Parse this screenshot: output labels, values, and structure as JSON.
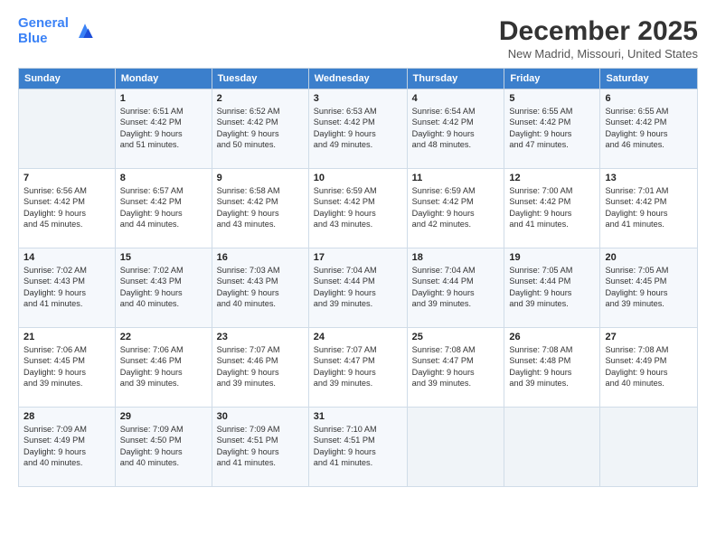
{
  "header": {
    "logo_line1": "General",
    "logo_line2": "Blue",
    "month": "December 2025",
    "location": "New Madrid, Missouri, United States"
  },
  "weekdays": [
    "Sunday",
    "Monday",
    "Tuesday",
    "Wednesday",
    "Thursday",
    "Friday",
    "Saturday"
  ],
  "weeks": [
    [
      {
        "num": "",
        "info": ""
      },
      {
        "num": "1",
        "info": "Sunrise: 6:51 AM\nSunset: 4:42 PM\nDaylight: 9 hours\nand 51 minutes."
      },
      {
        "num": "2",
        "info": "Sunrise: 6:52 AM\nSunset: 4:42 PM\nDaylight: 9 hours\nand 50 minutes."
      },
      {
        "num": "3",
        "info": "Sunrise: 6:53 AM\nSunset: 4:42 PM\nDaylight: 9 hours\nand 49 minutes."
      },
      {
        "num": "4",
        "info": "Sunrise: 6:54 AM\nSunset: 4:42 PM\nDaylight: 9 hours\nand 48 minutes."
      },
      {
        "num": "5",
        "info": "Sunrise: 6:55 AM\nSunset: 4:42 PM\nDaylight: 9 hours\nand 47 minutes."
      },
      {
        "num": "6",
        "info": "Sunrise: 6:55 AM\nSunset: 4:42 PM\nDaylight: 9 hours\nand 46 minutes."
      }
    ],
    [
      {
        "num": "7",
        "info": "Sunrise: 6:56 AM\nSunset: 4:42 PM\nDaylight: 9 hours\nand 45 minutes."
      },
      {
        "num": "8",
        "info": "Sunrise: 6:57 AM\nSunset: 4:42 PM\nDaylight: 9 hours\nand 44 minutes."
      },
      {
        "num": "9",
        "info": "Sunrise: 6:58 AM\nSunset: 4:42 PM\nDaylight: 9 hours\nand 43 minutes."
      },
      {
        "num": "10",
        "info": "Sunrise: 6:59 AM\nSunset: 4:42 PM\nDaylight: 9 hours\nand 43 minutes."
      },
      {
        "num": "11",
        "info": "Sunrise: 6:59 AM\nSunset: 4:42 PM\nDaylight: 9 hours\nand 42 minutes."
      },
      {
        "num": "12",
        "info": "Sunrise: 7:00 AM\nSunset: 4:42 PM\nDaylight: 9 hours\nand 41 minutes."
      },
      {
        "num": "13",
        "info": "Sunrise: 7:01 AM\nSunset: 4:42 PM\nDaylight: 9 hours\nand 41 minutes."
      }
    ],
    [
      {
        "num": "14",
        "info": "Sunrise: 7:02 AM\nSunset: 4:43 PM\nDaylight: 9 hours\nand 41 minutes."
      },
      {
        "num": "15",
        "info": "Sunrise: 7:02 AM\nSunset: 4:43 PM\nDaylight: 9 hours\nand 40 minutes."
      },
      {
        "num": "16",
        "info": "Sunrise: 7:03 AM\nSunset: 4:43 PM\nDaylight: 9 hours\nand 40 minutes."
      },
      {
        "num": "17",
        "info": "Sunrise: 7:04 AM\nSunset: 4:44 PM\nDaylight: 9 hours\nand 39 minutes."
      },
      {
        "num": "18",
        "info": "Sunrise: 7:04 AM\nSunset: 4:44 PM\nDaylight: 9 hours\nand 39 minutes."
      },
      {
        "num": "19",
        "info": "Sunrise: 7:05 AM\nSunset: 4:44 PM\nDaylight: 9 hours\nand 39 minutes."
      },
      {
        "num": "20",
        "info": "Sunrise: 7:05 AM\nSunset: 4:45 PM\nDaylight: 9 hours\nand 39 minutes."
      }
    ],
    [
      {
        "num": "21",
        "info": "Sunrise: 7:06 AM\nSunset: 4:45 PM\nDaylight: 9 hours\nand 39 minutes."
      },
      {
        "num": "22",
        "info": "Sunrise: 7:06 AM\nSunset: 4:46 PM\nDaylight: 9 hours\nand 39 minutes."
      },
      {
        "num": "23",
        "info": "Sunrise: 7:07 AM\nSunset: 4:46 PM\nDaylight: 9 hours\nand 39 minutes."
      },
      {
        "num": "24",
        "info": "Sunrise: 7:07 AM\nSunset: 4:47 PM\nDaylight: 9 hours\nand 39 minutes."
      },
      {
        "num": "25",
        "info": "Sunrise: 7:08 AM\nSunset: 4:47 PM\nDaylight: 9 hours\nand 39 minutes."
      },
      {
        "num": "26",
        "info": "Sunrise: 7:08 AM\nSunset: 4:48 PM\nDaylight: 9 hours\nand 39 minutes."
      },
      {
        "num": "27",
        "info": "Sunrise: 7:08 AM\nSunset: 4:49 PM\nDaylight: 9 hours\nand 40 minutes."
      }
    ],
    [
      {
        "num": "28",
        "info": "Sunrise: 7:09 AM\nSunset: 4:49 PM\nDaylight: 9 hours\nand 40 minutes."
      },
      {
        "num": "29",
        "info": "Sunrise: 7:09 AM\nSunset: 4:50 PM\nDaylight: 9 hours\nand 40 minutes."
      },
      {
        "num": "30",
        "info": "Sunrise: 7:09 AM\nSunset: 4:51 PM\nDaylight: 9 hours\nand 41 minutes."
      },
      {
        "num": "31",
        "info": "Sunrise: 7:10 AM\nSunset: 4:51 PM\nDaylight: 9 hours\nand 41 minutes."
      },
      {
        "num": "",
        "info": ""
      },
      {
        "num": "",
        "info": ""
      },
      {
        "num": "",
        "info": ""
      }
    ]
  ]
}
